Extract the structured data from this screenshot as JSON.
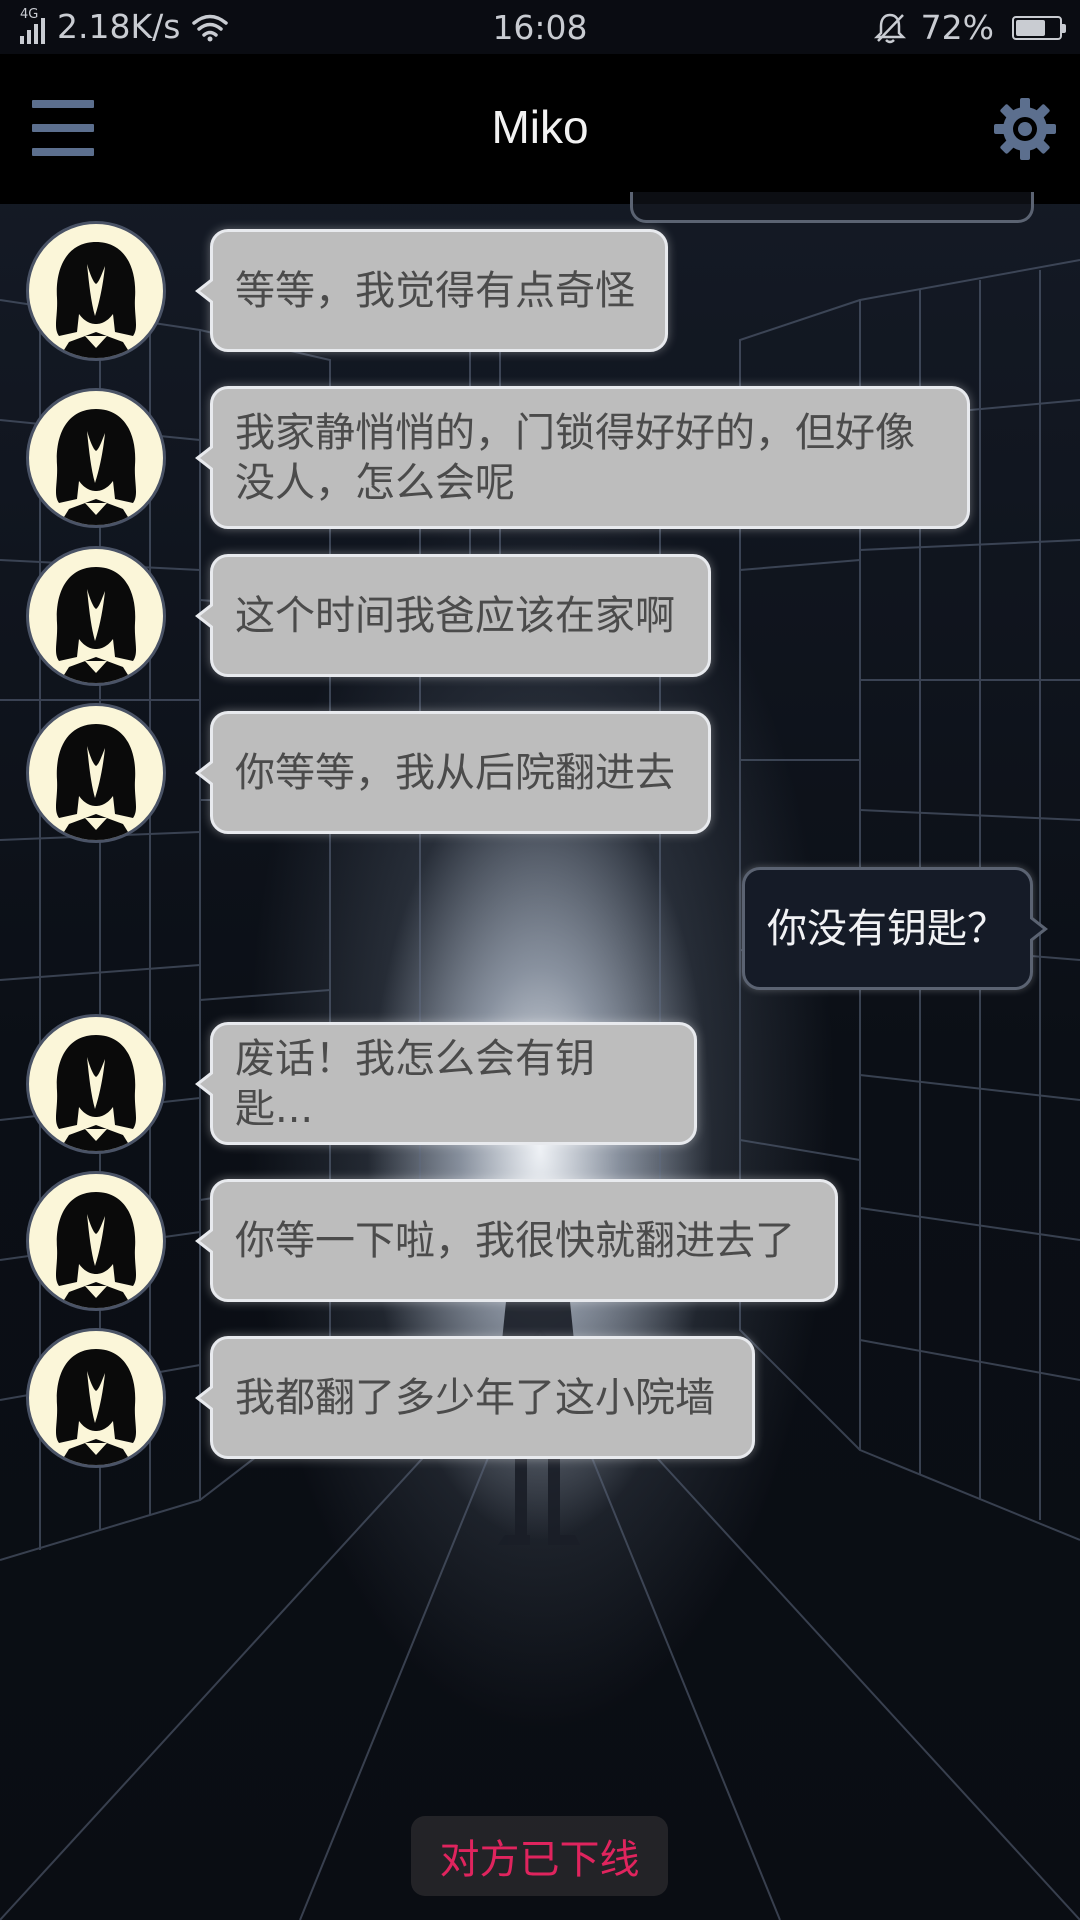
{
  "status_bar": {
    "network_type": "4G",
    "net_speed": "2.18K/s",
    "time": "16:08",
    "battery_percent": "72%",
    "battery_level": 0.72,
    "icons": [
      "signal-icon",
      "wifi-icon",
      "bell-muted-icon",
      "battery-icon"
    ]
  },
  "header": {
    "title": "Miko",
    "menu_icon": "hamburger-menu-icon",
    "settings_icon": "gear-icon",
    "accent_color": "#5c6f8e"
  },
  "messages": [
    {
      "sender": "miko",
      "text": "等等，我觉得有点奇怪"
    },
    {
      "sender": "miko",
      "text": "我家静悄悄的，门锁得好好的，但好像没人，怎么会呢"
    },
    {
      "sender": "miko",
      "text": "这个时间我爸应该在家啊"
    },
    {
      "sender": "miko",
      "text": "你等等，我从后院翻进去"
    },
    {
      "sender": "me",
      "text": "你没有钥匙？"
    },
    {
      "sender": "miko",
      "text": "废话！我怎么会有钥匙..."
    },
    {
      "sender": "miko",
      "text": "你等一下啦，我很快就翻进去了"
    },
    {
      "sender": "miko",
      "text": "我都翻了多少年了这小院墙"
    }
  ],
  "footer": {
    "offline_notice": "对方已下线",
    "offline_color": "#e0245e"
  },
  "colors": {
    "incoming_bubble": "#bdbdbd",
    "outgoing_bubble": "#151b27",
    "avatar_bg": "#fbf6d9"
  }
}
